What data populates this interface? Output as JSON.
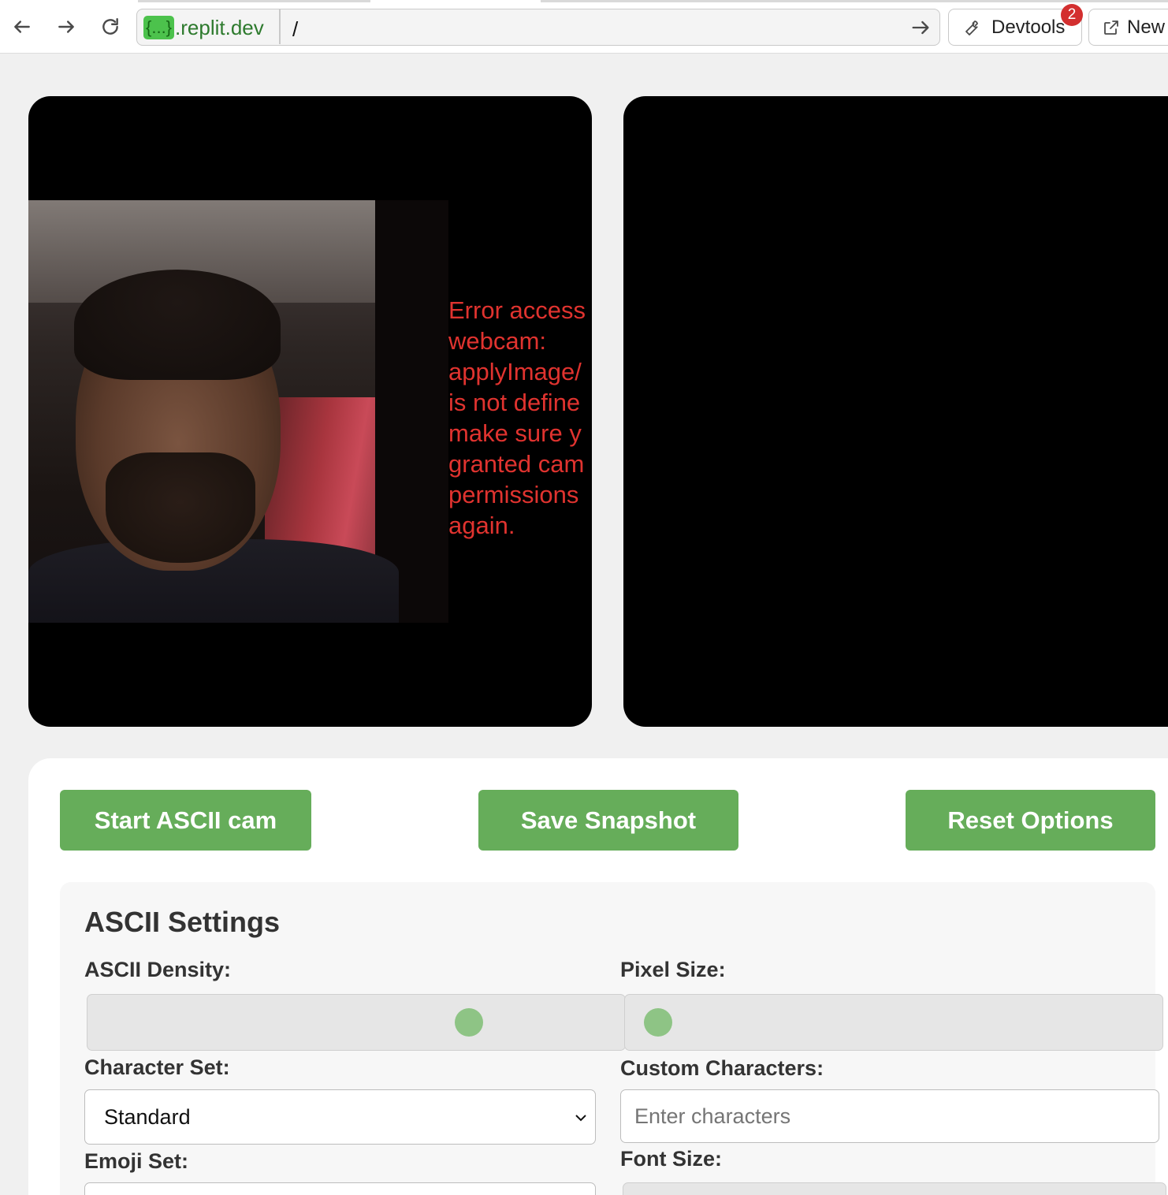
{
  "browser": {
    "url_host_badge": "{...}",
    "url_host": ".replit.dev",
    "url_path": "/",
    "devtools_label": "Devtools",
    "devtools_badge": "2",
    "new_tab_label": "New"
  },
  "webcam": {
    "error_lines": [
      "Error access",
      "webcam:",
      "applyImage/",
      "is not define",
      "make sure y",
      "granted cam",
      "permissions",
      "again."
    ]
  },
  "buttons": {
    "start": "Start ASCII cam",
    "save": "Save Snapshot",
    "reset": "Reset Options"
  },
  "settings": {
    "title": "ASCII Settings",
    "density_label": "ASCII Density:",
    "density_value": 0.73,
    "pixel_size_label": "Pixel Size:",
    "pixel_size_value": 0.02,
    "charset_label": "Character Set:",
    "charset_value": "Standard",
    "custom_chars_label": "Custom Characters:",
    "custom_chars_placeholder": "Enter characters",
    "emoji_label": "Emoji Set:",
    "font_size_label": "Font Size:"
  },
  "colors": {
    "button_green": "#66ad5a",
    "slider_thumb": "#8ec485",
    "error_red": "#e0332f"
  }
}
